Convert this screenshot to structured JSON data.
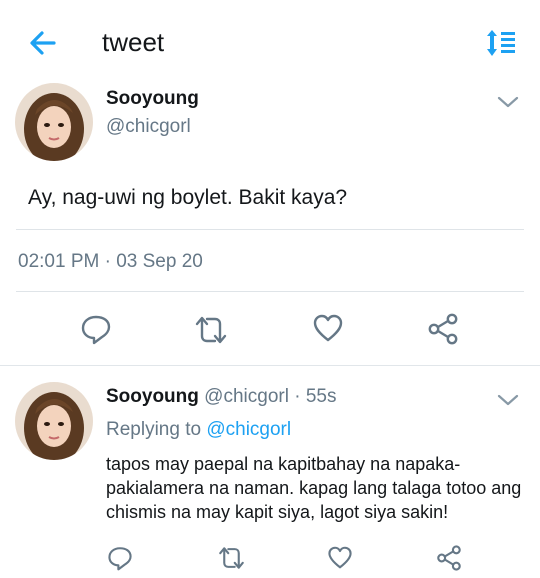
{
  "topbar": {
    "title": "tweet",
    "back_icon": "arrow-left-icon",
    "sort_icon": "sort-icon",
    "accent_color": "#1da1f2"
  },
  "main_tweet": {
    "display_name": "Sooyoung",
    "handle": "@chicgorl",
    "text": "Ay, nag-uwi ng boylet. Bakit kaya?",
    "timestamp": "02:01 PM · 03 Sep 20",
    "avatar_icon": "avatar",
    "menu_icon": "chevron-down-icon"
  },
  "actions": {
    "icons": [
      "reply-icon",
      "retweet-icon",
      "like-icon",
      "share-icon"
    ],
    "icon_color": "#657786"
  },
  "reply_tweet": {
    "display_name": "Sooyoung",
    "handle": "@chicgorl",
    "time_ago": "· 55s",
    "replying_prefix": "Replying to",
    "replying_to": "@chicgorl",
    "text": "tapos may paepal na kapitbahay na napaka-pakialamera na naman. kapag lang talaga totoo ang chismis na may kapit siya, lagot siya sakin!",
    "menu_icon": "chevron-down-icon"
  }
}
